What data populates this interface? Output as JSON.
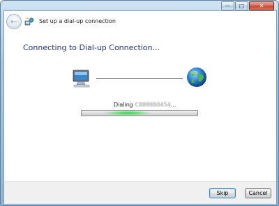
{
  "window": {
    "controls": {
      "minimize": "—",
      "maximize": "□",
      "close": "✕"
    }
  },
  "header": {
    "back_icon": "back-arrow-icon",
    "title": "Set up a dial-up connection"
  },
  "main": {
    "heading": "Connecting to Dial-up Connection...",
    "status_prefix": "Dialing ",
    "status_number": "C888880454",
    "status_suffix": "...",
    "progress": {
      "state": "indeterminate",
      "glow_position": 0.35
    }
  },
  "footer": {
    "skip_label": "Skip",
    "cancel_label": "Cancel"
  },
  "colors": {
    "heading": "#1e3287",
    "progress_glow": "#2fd14a",
    "frame": "#a9c9e3"
  }
}
